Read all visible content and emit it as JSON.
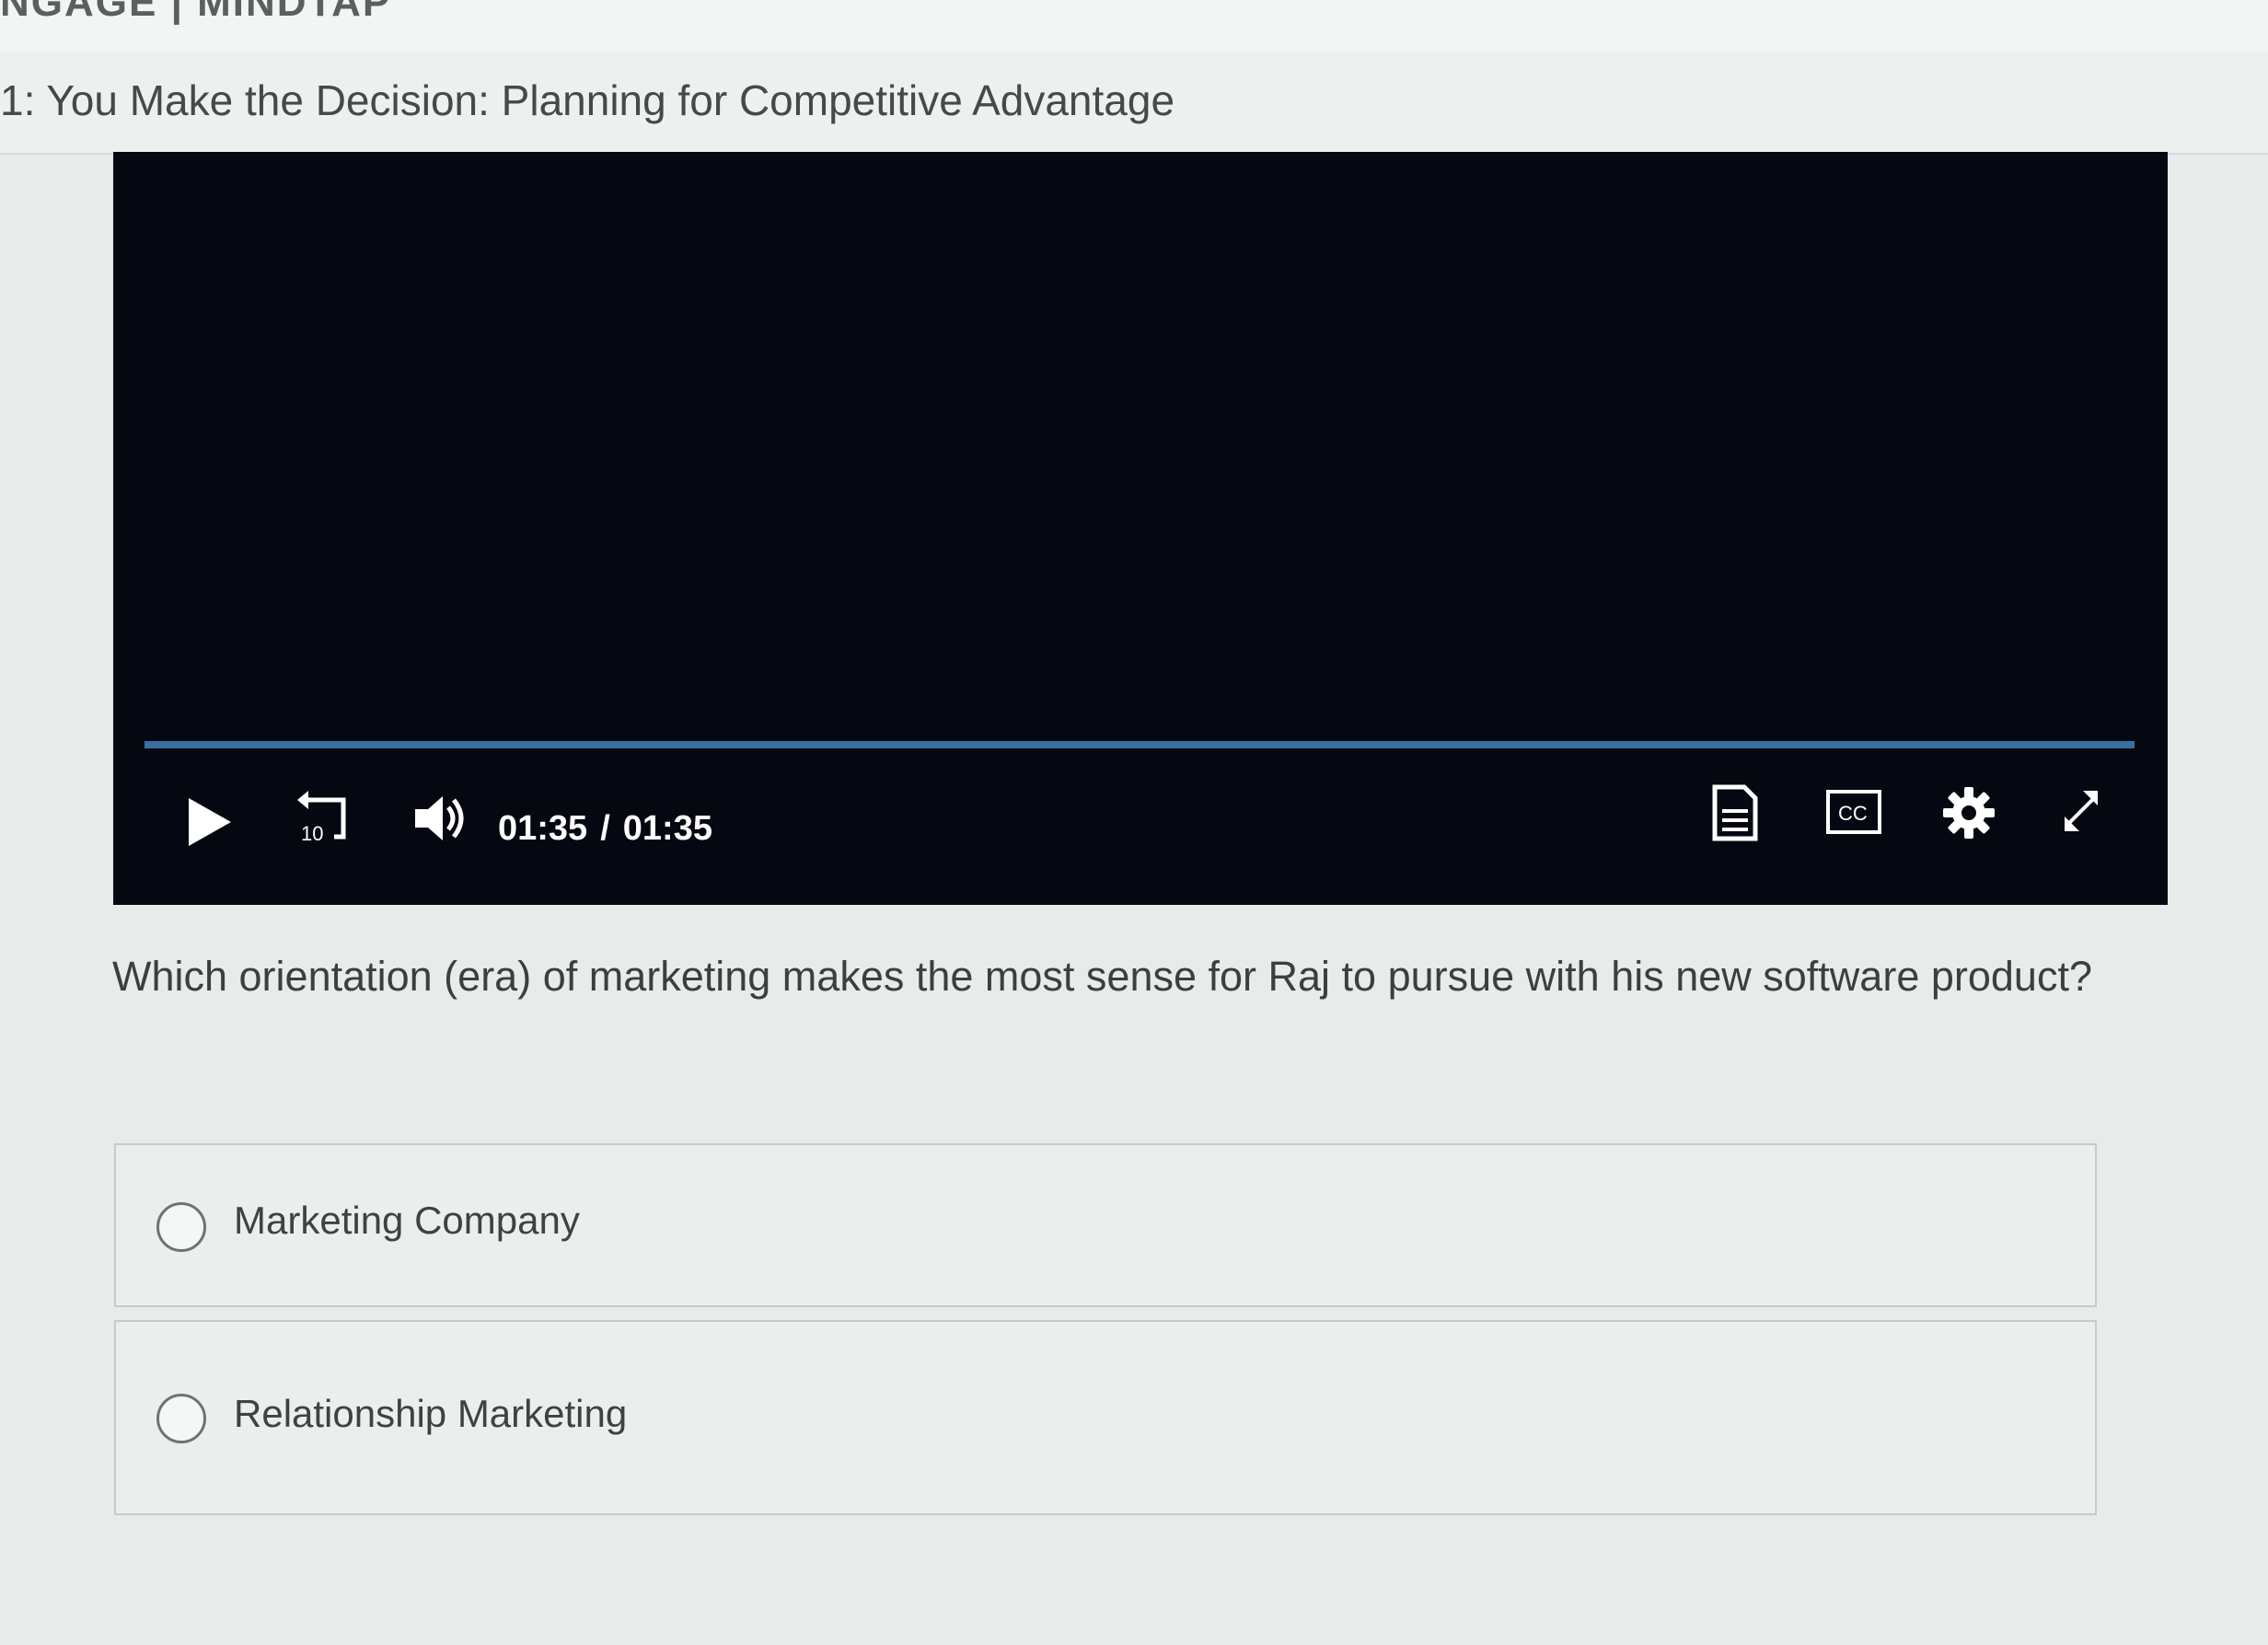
{
  "header": {
    "brand": "NGAGE | MINDTAP"
  },
  "page": {
    "title": "1: You Make the Decision: Planning for Competitive Advantage"
  },
  "player": {
    "current_time": "01:35",
    "separator": "/",
    "duration": "01:35",
    "progress": 1.0,
    "skip_back_label": "10",
    "cc_label": "CC",
    "icons": [
      "play-icon",
      "replay-10-icon",
      "volume-icon",
      "transcript-icon",
      "cc-icon",
      "gear-icon",
      "fullscreen-icon"
    ],
    "colors": {
      "background": "#050810",
      "progress": "#3a6f9e"
    }
  },
  "question": {
    "text": "Which orientation (era) of marketing makes the most sense for Raj to pursue with his new software product?",
    "options": [
      {
        "label": "Marketing Company",
        "selected": false
      },
      {
        "label": "Relationship Marketing",
        "selected": false
      }
    ]
  }
}
